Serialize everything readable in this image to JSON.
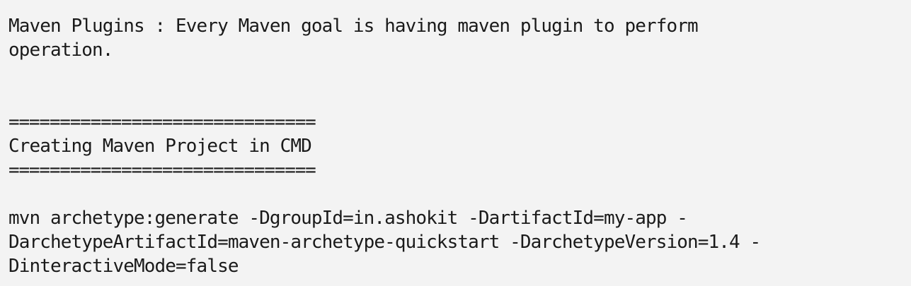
{
  "editor": {
    "lines": [
      "Maven Plugins : Every Maven goal is having maven plugin to perform",
      "operation.",
      "",
      "",
      "==============================",
      "Creating Maven Project in CMD",
      "==============================",
      "",
      "mvn archetype:generate -DgroupId=in.ashokit -DartifactId=my-app -",
      "DarchetypeArtifactId=maven-archetype-quickstart -DarchetypeVersion=1.4 -",
      "DinteractiveMode=false"
    ]
  }
}
